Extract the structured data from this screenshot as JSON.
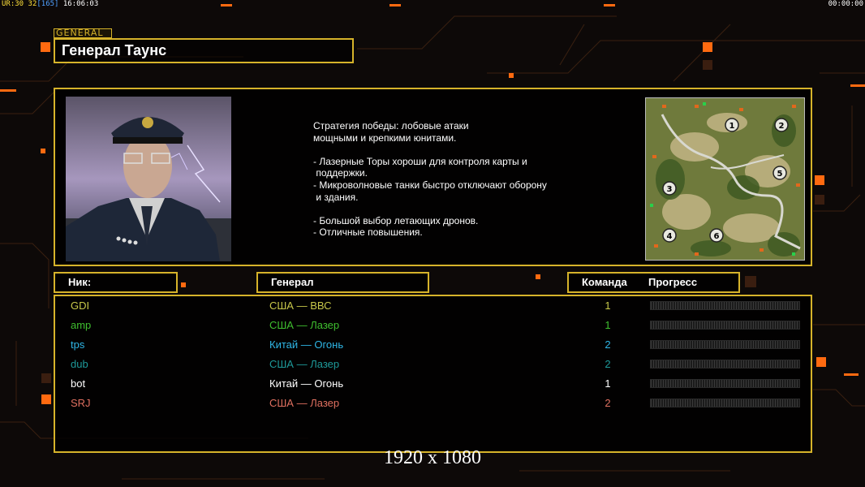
{
  "hud": {
    "ur_label": "UR:",
    "fps1": "30",
    "fps2": "32",
    "bracket": "[165]",
    "clock": "16:06:03",
    "timer": "00:00:00"
  },
  "general": {
    "tag": "GENERAL",
    "name": "Генерал Таунс",
    "strategy_lines": [
      "Стратегия победы: лобовые атаки",
      "мощными и крепкими юнитами.",
      "",
      "- Лазерные Торы хороши для контроля карты и",
      " поддержки.",
      "- Микроволновые танки быстро отключают оборону",
      " и здания.",
      "",
      "- Большой выбор летающих дронов.",
      "- Отличные повышения."
    ]
  },
  "minimap": {
    "start_positions": [
      "1",
      "2",
      "3",
      "4",
      "5",
      "6"
    ]
  },
  "table": {
    "headers": {
      "nick": "Ник:",
      "general": "Генерал",
      "team": "Команда",
      "progress": "Прогресс"
    },
    "rows": [
      {
        "nick": "GDI",
        "general": "США — ВВС",
        "team": "1",
        "progress": 0,
        "color": "#c8c84a"
      },
      {
        "nick": "amp",
        "general": "США — Лазер",
        "team": "1",
        "progress": 0,
        "color": "#3fbf2f"
      },
      {
        "nick": "tps",
        "general": "Китай — Огонь",
        "team": "2",
        "progress": 0,
        "color": "#2fb6e6"
      },
      {
        "nick": "dub",
        "general": "США — Лазер",
        "team": "2",
        "progress": 0,
        "color": "#1e9a9a"
      },
      {
        "nick": "bot",
        "general": "Китай — Огонь",
        "team": "1",
        "progress": 0,
        "color": "#ffffff"
      },
      {
        "nick": "SRJ",
        "general": "США — Лазер",
        "team": "2",
        "progress": 0,
        "color": "#e07060"
      }
    ]
  },
  "resolution": "1920 x 1080",
  "colors": {
    "frame": "#d6b32a",
    "accent_orange": "#ff6a10"
  }
}
